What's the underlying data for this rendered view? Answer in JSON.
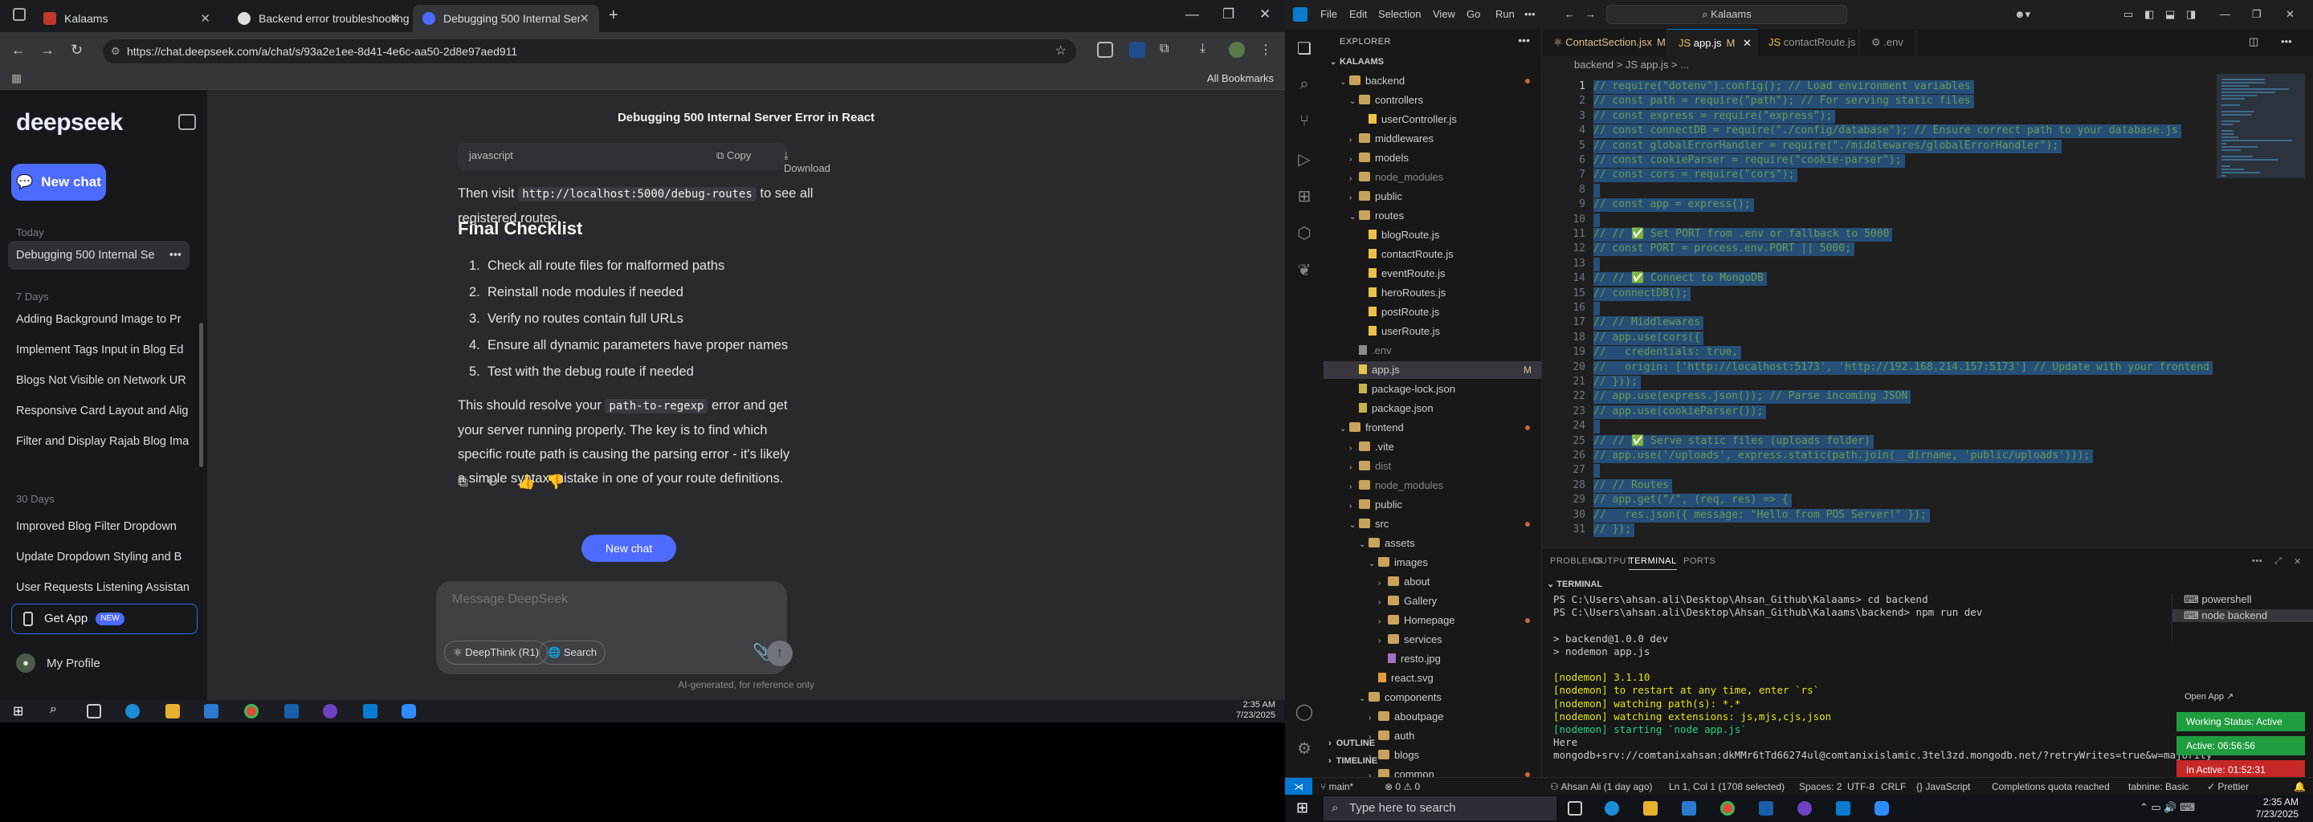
{
  "browser": {
    "tabs": [
      {
        "label": "Kalaams"
      },
      {
        "label": "Backend error troubleshooting"
      },
      {
        "label": "Debugging 500 Internal Server"
      }
    ],
    "url": "https://chat.deepseek.com/a/chat/s/93a2e1ee-8d41-4e6c-aa50-2d8e97aed911",
    "all_bookmarks": "All Bookmarks"
  },
  "deepseek": {
    "logo": "deepseek",
    "new_chat": "New chat",
    "sections": {
      "today": "Today",
      "seven_days": "7 Days",
      "thirty_days": "30 Days"
    },
    "today_items": [
      "Debugging 500 Internal Se"
    ],
    "week_items": [
      "Adding Background Image to Pr",
      "Implement Tags Input in Blog Ed",
      "Blogs Not Visible on Network UR",
      "Responsive Card Layout and Alig",
      "Filter and Display Rajab Blog Ima"
    ],
    "month_items": [
      "Improved Blog Filter Dropdown",
      "Update Dropdown Styling and B",
      "User Requests Listening Assistan"
    ],
    "get_app": "Get App",
    "new_badge": "NEW",
    "profile": "My Profile",
    "chat_title": "Debugging 500 Internal Server Error in React",
    "code_lang": "javascript",
    "copy": "Copy",
    "download": "Download",
    "visit_pre": "Then visit ",
    "visit_code": "http://localhost:5000/debug-routes",
    "visit_post": " to see all registered routes.",
    "final_heading": "Final Checklist",
    "checklist": [
      "Check all route files for malformed paths",
      "Reinstall node modules if needed",
      "Verify no routes contain full URLs",
      "Ensure all dynamic parameters have proper names",
      "Test with the debug route if needed"
    ],
    "resolve_pre": "This should resolve your ",
    "resolve_code": "path-to-regexp",
    "resolve_post": " error and get your server running properly. The key is to find which specific route path is causing the parsing error - it's likely a simple syntax mistake in one of your route definitions.",
    "new_chat_center": "New chat",
    "input_placeholder": "Message DeepSeek",
    "deepthink": "DeepThink (R1)",
    "search": "Search",
    "disclaimer": "AI-generated, for reference only"
  },
  "left_clock": {
    "time": "2:35 AM",
    "date": "7/23/2025"
  },
  "vscode": {
    "menus": [
      "File",
      "Edit",
      "Selection",
      "View",
      "Go",
      "Run"
    ],
    "command_center": "Kalaams",
    "explorer_title": "EXPLORER",
    "tree": [
      {
        "label": "KALAAMS",
        "depth": 0,
        "kind": "root"
      },
      {
        "label": "backend",
        "depth": 1,
        "kind": "folder-open",
        "dot": true
      },
      {
        "label": "controllers",
        "depth": 2,
        "kind": "folder-open"
      },
      {
        "label": "userController.js",
        "depth": 3,
        "kind": "js"
      },
      {
        "label": "middlewares",
        "depth": 2,
        "kind": "folder"
      },
      {
        "label": "models",
        "depth": 2,
        "kind": "folder"
      },
      {
        "label": "node_modules",
        "depth": 2,
        "kind": "folder",
        "dim": true
      },
      {
        "label": "public",
        "depth": 2,
        "kind": "folder"
      },
      {
        "label": "routes",
        "depth": 2,
        "kind": "folder-open"
      },
      {
        "label": "blogRoute.js",
        "depth": 3,
        "kind": "js"
      },
      {
        "label": "contactRoute.js",
        "depth": 3,
        "kind": "js"
      },
      {
        "label": "eventRoute.js",
        "depth": 3,
        "kind": "js"
      },
      {
        "label": "heroRoutes.js",
        "depth": 3,
        "kind": "js"
      },
      {
        "label": "postRoute.js",
        "depth": 3,
        "kind": "js"
      },
      {
        "label": "userRoute.js",
        "depth": 3,
        "kind": "js"
      },
      {
        "label": ".env",
        "depth": 2,
        "kind": "env",
        "dim": true
      },
      {
        "label": "app.js",
        "depth": 2,
        "kind": "js",
        "badge": "M",
        "selected": true
      },
      {
        "label": "package-lock.json",
        "depth": 2,
        "kind": "json"
      },
      {
        "label": "package.json",
        "depth": 2,
        "kind": "json"
      },
      {
        "label": "frontend",
        "depth": 1,
        "kind": "folder-open",
        "dot": true
      },
      {
        "label": ".vite",
        "depth": 2,
        "kind": "folder"
      },
      {
        "label": "dist",
        "depth": 2,
        "kind": "folder",
        "dim": true
      },
      {
        "label": "node_modules",
        "depth": 2,
        "kind": "folder",
        "dim": true
      },
      {
        "label": "public",
        "depth": 2,
        "kind": "folder"
      },
      {
        "label": "src",
        "depth": 2,
        "kind": "folder-open",
        "dot": true
      },
      {
        "label": "assets",
        "depth": 3,
        "kind": "folder-open"
      },
      {
        "label": "images",
        "depth": 4,
        "kind": "folder-open"
      },
      {
        "label": "about",
        "depth": 5,
        "kind": "folder"
      },
      {
        "label": "Gallery",
        "depth": 5,
        "kind": "folder"
      },
      {
        "label": "Homepage",
        "depth": 5,
        "kind": "folder",
        "dot": true
      },
      {
        "label": "services",
        "depth": 5,
        "kind": "folder"
      },
      {
        "label": "resto.jpg",
        "depth": 5,
        "kind": "img"
      },
      {
        "label": "react.svg",
        "depth": 4,
        "kind": "svg"
      },
      {
        "label": "components",
        "depth": 3,
        "kind": "folder-open"
      },
      {
        "label": "aboutpage",
        "depth": 4,
        "kind": "folder"
      },
      {
        "label": "auth",
        "depth": 4,
        "kind": "folder"
      },
      {
        "label": "blogs",
        "depth": 4,
        "kind": "folder"
      },
      {
        "label": "common",
        "depth": 4,
        "kind": "folder",
        "dot": true
      }
    ],
    "outline": "OUTLINE",
    "timeline": "TIMELINE",
    "editor_tabs": [
      {
        "label": "ContactSection.jsx",
        "badge": "M"
      },
      {
        "label": "app.js",
        "badge": "M",
        "active": true
      },
      {
        "label": "contactRoute.js",
        "badge": ""
      },
      {
        "label": ".env",
        "badge": ""
      }
    ],
    "breadcrumb": "backend  >  JS app.js  >  ...",
    "code_lines": [
      "// require(\"dotenv\").config(); // Load environment variables",
      "// const path = require(\"path\"); // For serving static files",
      "// const express = require(\"express\");",
      "// const connectDB = require(\"./config/database\"); // Ensure correct path to your database.js",
      "// const globalErrorHandler = require(\"./middlewares/globalErrorHandler\");",
      "// const cookieParser = require(\"cookie-parser\");",
      "// const cors = require(\"cors\");",
      "",
      "// const app = express();",
      "",
      "// // ✅ Set PORT from .env or fallback to 5000",
      "// const PORT = process.env.PORT || 5000;",
      "",
      "// // ✅ Connect to MongoDB",
      "// connectDB();",
      "",
      "// // Middlewares",
      "// app.use(cors({",
      "//   credentials: true,",
      "//   origin: ['http://localhost:5173', 'http://192.168.214.157:5173'] // Update with your frontend",
      "// }));",
      "// app.use(express.json()); // Parse incoming JSON",
      "// app.use(cookieParser());",
      "",
      "// // ✅ Serve static files (uploads folder)",
      "// app.use('/uploads', express.static(path.join(__dirname, 'public/uploads')));",
      "",
      "// // Routes",
      "// app.get(\"/\", (req, res) => {",
      "//   res.json({ message: \"Hello from POS Server!\" });",
      "// });"
    ],
    "panel_tabs": [
      "PROBLEMS",
      "OUTPUT",
      "TERMINAL",
      "PORTS"
    ],
    "terminal_title": "TERMINAL",
    "terminal_lines": [
      "PS C:\\Users\\ahsan.ali\\Desktop\\Ahsan_Github\\Kalaams> cd backend",
      "PS C:\\Users\\ahsan.ali\\Desktop\\Ahsan_Github\\Kalaams\\backend> npm run dev",
      "",
      "> backend@1.0.0 dev",
      "> nodemon app.js",
      "",
      "[nodemon] 3.1.10",
      "[nodemon] to restart at any time, enter `rs`",
      "[nodemon] watching path(s): *.*",
      "[nodemon] watching extensions: js,mjs,cjs,json",
      "[nodemon] starting `node app.js`",
      "Here",
      "mongodb+srv://comtanixahsan:dkMMr6tTd66274ul@comtanixislamic.3tel3zd.mongodb.net/?retryWrites=true&w=majority"
    ],
    "terminals": [
      {
        "label": "powershell"
      },
      {
        "label": "node  backend"
      }
    ],
    "open_app": "Open App ↗",
    "working_status": "Working Status: Active",
    "active_time": "Active: 06:56:56",
    "inactive_time": "In Active: 01:52:31",
    "status": {
      "branch": "main*",
      "errors": "⊗ 0  ⚠ 0",
      "blame": "Ahsan Ali (1 day ago)",
      "position": "Ln 1, Col 1 (1708 selected)",
      "spaces": "Spaces: 2",
      "encoding": "UTF-8",
      "eol": "CRLF",
      "language": "{} JavaScript",
      "quota": "Completions quota reached",
      "tabnine": "tabnine: Basic",
      "prettier": "✓ Prettier"
    },
    "taskbar_search": "Type here to search",
    "clock": {
      "time": "2:35 AM",
      "date": "7/23/2025"
    }
  }
}
